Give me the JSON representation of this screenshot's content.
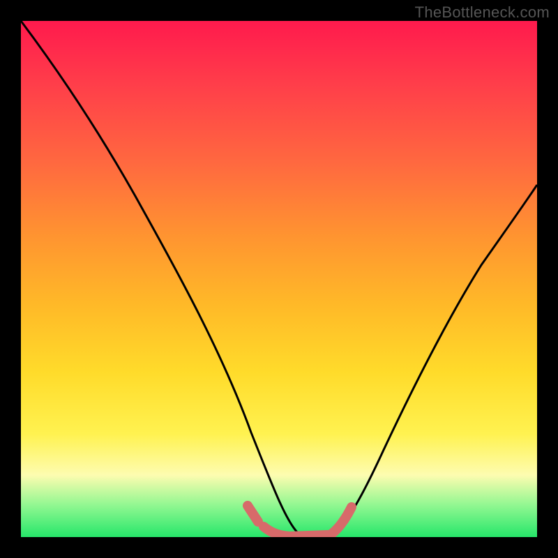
{
  "watermark": {
    "text": "TheBottleneck.com"
  },
  "colors": {
    "curve": "#000000",
    "fit_stroke": "#d76a6a",
    "fit_fill": "#d76a6a",
    "gradient_stops": [
      "#ff1a4d",
      "#ff3d4a",
      "#ff6a3f",
      "#ff9530",
      "#ffb928",
      "#ffdb2a",
      "#fff250",
      "#fdfcb0",
      "#8ef790",
      "#26e66a"
    ]
  },
  "chart_data": {
    "type": "line",
    "title": "",
    "xlabel": "",
    "ylabel": "",
    "xlim": [
      0,
      100
    ],
    "ylim": [
      0,
      100
    ],
    "curve": [
      {
        "x": 0,
        "y": 100
      },
      {
        "x": 5,
        "y": 91
      },
      {
        "x": 10,
        "y": 81
      },
      {
        "x": 15,
        "y": 70
      },
      {
        "x": 20,
        "y": 58
      },
      {
        "x": 25,
        "y": 46
      },
      {
        "x": 30,
        "y": 34
      },
      {
        "x": 35,
        "y": 23
      },
      {
        "x": 40,
        "y": 13
      },
      {
        "x": 45,
        "y": 5
      },
      {
        "x": 48,
        "y": 1
      },
      {
        "x": 50,
        "y": 0
      },
      {
        "x": 55,
        "y": 0
      },
      {
        "x": 60,
        "y": 0
      },
      {
        "x": 63,
        "y": 1
      },
      {
        "x": 66,
        "y": 6
      },
      {
        "x": 70,
        "y": 14
      },
      {
        "x": 75,
        "y": 24
      },
      {
        "x": 80,
        "y": 33
      },
      {
        "x": 85,
        "y": 42
      },
      {
        "x": 90,
        "y": 50
      },
      {
        "x": 95,
        "y": 57
      },
      {
        "x": 100,
        "y": 63
      }
    ],
    "fit_region": {
      "x_start": 46,
      "x_end": 64
    }
  }
}
